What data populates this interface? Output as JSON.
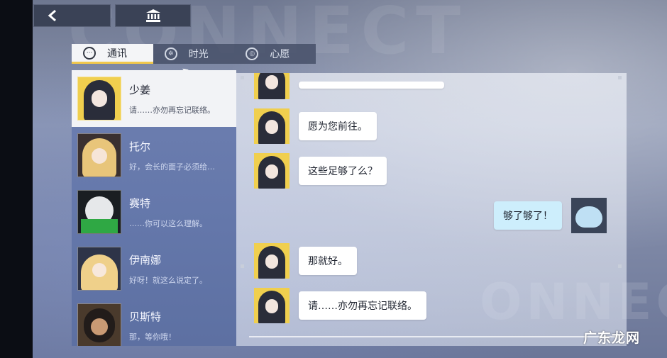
{
  "topbar": {
    "back_icon": "back-arrow-icon",
    "home_icon": "bank-icon"
  },
  "tabs": [
    {
      "label": "通讯",
      "icon": "chat-bubble-icon",
      "active": true
    },
    {
      "label": "时光",
      "icon": "aperture-icon",
      "active": false
    },
    {
      "label": "心愿",
      "icon": "swirl-icon",
      "active": false
    }
  ],
  "contacts": [
    {
      "name": "少姜",
      "preview": "请……亦勿再忘记联络。",
      "active": true
    },
    {
      "name": "托尔",
      "preview": "好，会长的面子必须给…",
      "active": false
    },
    {
      "name": "赛特",
      "preview": "……你可以这么理解。",
      "active": false
    },
    {
      "name": "伊南娜",
      "preview": "好呀！就这么说定了。",
      "active": false
    },
    {
      "name": "贝斯特",
      "preview": "那，等你哦！",
      "active": false
    }
  ],
  "messages": [
    {
      "side": "left",
      "text": ""
    },
    {
      "side": "left",
      "text": "愿为您前往。"
    },
    {
      "side": "left",
      "text": "这些足够了么？"
    },
    {
      "side": "right",
      "text": "够了够了！"
    },
    {
      "side": "left",
      "text": "那就好。"
    },
    {
      "side": "left",
      "text": "请……亦勿再忘记联络。"
    }
  ],
  "background": {
    "watermark_top": "CONNECT",
    "watermark_bottom": "ONNECT"
  },
  "site_watermark": "广东龙网",
  "colors": {
    "accent": "#f2c84b",
    "panel": "#6578ab",
    "my_bubble": "#cdeefc"
  }
}
